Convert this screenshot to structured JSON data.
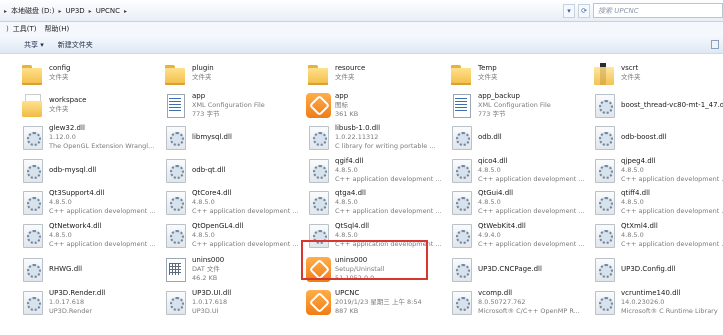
{
  "address": {
    "crumbs": [
      "本地磁盘 (D:)",
      "UP3D",
      "UPCNC"
    ],
    "search_placeholder": "搜索 UPCNC"
  },
  "menu": {
    "lead": ")",
    "items": [
      "工具(T)",
      "帮助(H)"
    ]
  },
  "toolbar": {
    "share_label": "共享 ▾",
    "new_folder_label": "新建文件夹"
  },
  "files": [
    {
      "icon": "folder",
      "name": "config",
      "meta": [
        "文件夹"
      ]
    },
    {
      "icon": "folder",
      "name": "plugin",
      "meta": [
        "文件夹"
      ]
    },
    {
      "icon": "folder",
      "name": "resource",
      "meta": [
        "文件夹"
      ]
    },
    {
      "icon": "folder",
      "name": "Temp",
      "meta": [
        "文件夹"
      ]
    },
    {
      "icon": "folder-dark",
      "name": "vscrt",
      "meta": [
        "文件夹"
      ]
    },
    {
      "icon": "folder-doc",
      "name": "workspace",
      "meta": [
        "文件夹"
      ]
    },
    {
      "icon": "xml",
      "name": "app",
      "meta": [
        "XML Configuration File",
        "773 字节"
      ]
    },
    {
      "icon": "app-orange",
      "name": "app",
      "meta": [
        "图标",
        "361 KB"
      ]
    },
    {
      "icon": "xml",
      "name": "app_backup",
      "meta": [
        "XML Configuration File",
        "773 字节"
      ]
    },
    {
      "icon": "dll",
      "name": "boost_thread-vc80-mt-1_47.dll",
      "meta": []
    },
    {
      "icon": "dll",
      "name": "glew32.dll",
      "meta": [
        "1.12.0.0",
        "The OpenGL Extension Wrangl..."
      ]
    },
    {
      "icon": "dll",
      "name": "libmysql.dll",
      "meta": []
    },
    {
      "icon": "dll",
      "name": "libusb-1.0.dll",
      "meta": [
        "1.0.22.11312",
        "C library for writing portable ..."
      ]
    },
    {
      "icon": "dll",
      "name": "odb.dll",
      "meta": []
    },
    {
      "icon": "dll",
      "name": "odb-boost.dll",
      "meta": []
    },
    {
      "icon": "dll",
      "name": "odb-mysql.dll",
      "meta": []
    },
    {
      "icon": "dll",
      "name": "odb-qt.dll",
      "meta": []
    },
    {
      "icon": "dll",
      "name": "qgif4.dll",
      "meta": [
        "4.8.5.0",
        "C++ application development ..."
      ]
    },
    {
      "icon": "dll",
      "name": "qico4.dll",
      "meta": [
        "4.8.5.0",
        "C++ application development ..."
      ]
    },
    {
      "icon": "dll",
      "name": "qjpeg4.dll",
      "meta": [
        "4.8.5.0",
        "C++ application development ..."
      ]
    },
    {
      "icon": "dll",
      "name": "Qt3Support4.dll",
      "meta": [
        "4.8.5.0",
        "C++ application development ..."
      ]
    },
    {
      "icon": "dll",
      "name": "QtCore4.dll",
      "meta": [
        "4.8.5.0",
        "C++ application development ..."
      ]
    },
    {
      "icon": "dll",
      "name": "qtga4.dll",
      "meta": [
        "4.8.5.0",
        "C++ application development ..."
      ]
    },
    {
      "icon": "dll",
      "name": "QtGui4.dll",
      "meta": [
        "4.8.5.0",
        "C++ application development ..."
      ]
    },
    {
      "icon": "dll",
      "name": "qtiff4.dll",
      "meta": [
        "4.8.5.0",
        "C++ application development ..."
      ]
    },
    {
      "icon": "dll",
      "name": "QtNetwork4.dll",
      "meta": [
        "4.8.5.0",
        "C++ application development ..."
      ]
    },
    {
      "icon": "dll",
      "name": "QtOpenGL4.dll",
      "meta": [
        "4.8.5.0",
        "C++ application development ..."
      ]
    },
    {
      "icon": "dll",
      "name": "QtSql4.dll",
      "meta": [
        "4.8.5.0",
        "C++ application development ..."
      ]
    },
    {
      "icon": "dll",
      "name": "QtWebKit4.dll",
      "meta": [
        "4.9.4.0",
        "C++ application development ..."
      ]
    },
    {
      "icon": "dll",
      "name": "QtXml4.dll",
      "meta": [
        "4.8.5.0",
        "C++ application development ..."
      ]
    },
    {
      "icon": "dll",
      "name": "RHWG.dll",
      "meta": []
    },
    {
      "icon": "dat",
      "name": "unins000",
      "meta": [
        "DAT 文件",
        "46.2 KB"
      ]
    },
    {
      "icon": "app-orange",
      "name": "unins000",
      "meta": [
        "Setup/Uninstall",
        "51.1052.0.0"
      ]
    },
    {
      "icon": "dll",
      "name": "UP3D.CNCPage.dll",
      "meta": []
    },
    {
      "icon": "dll",
      "name": "UP3D.Config.dll",
      "meta": []
    },
    {
      "icon": "dll",
      "name": "UP3D.Render.dll",
      "meta": [
        "1.0.17.618",
        "UP3D.Render"
      ]
    },
    {
      "icon": "dll",
      "name": "UP3D.UI.dll",
      "meta": [
        "1.0.17.618",
        "UP3D.UI"
      ]
    },
    {
      "icon": "app-orange",
      "name": "UPCNC",
      "meta": [
        "2019/1/23 星期三 上午 8:54",
        "887 KB"
      ]
    },
    {
      "icon": "dll",
      "name": "vcomp.dll",
      "meta": [
        "8.0.50727.762",
        "Microsoft® C/C++ OpenMP R..."
      ]
    },
    {
      "icon": "dll",
      "name": "vcruntime140.dll",
      "meta": [
        "14.0.23026.0",
        "Microsoft® C Runtime Library"
      ]
    }
  ]
}
